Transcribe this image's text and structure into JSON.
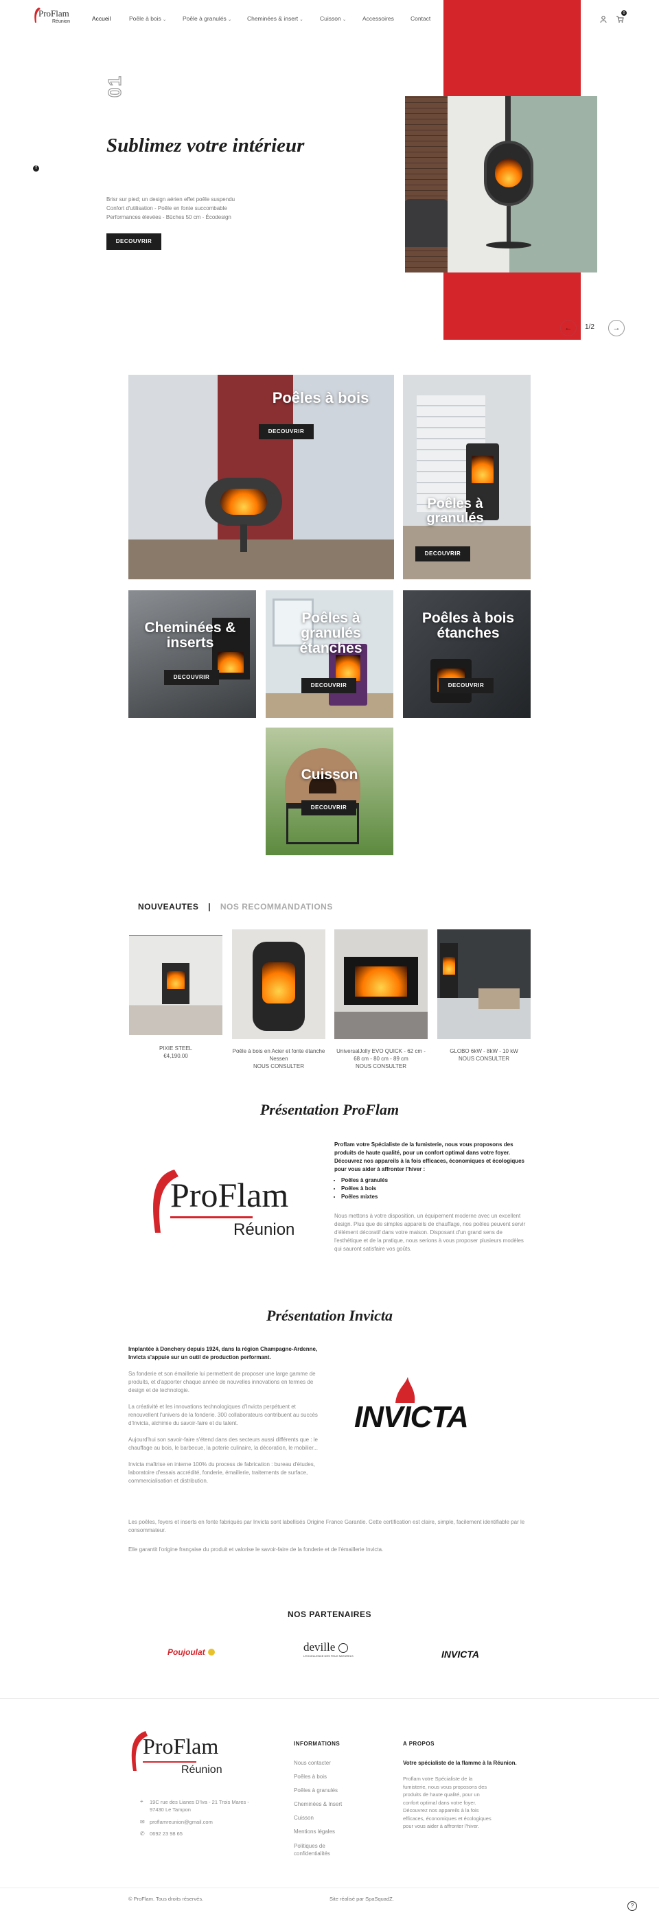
{
  "header": {
    "logo_main": "ProFlam",
    "logo_sub": "Réunion",
    "nav": [
      {
        "label": "Accueil",
        "chevron": false
      },
      {
        "label": "Poêle à bois",
        "chevron": true
      },
      {
        "label": "Poêle à granulés",
        "chevron": true
      },
      {
        "label": "Cheminées & insert",
        "chevron": true
      },
      {
        "label": "Cuisson",
        "chevron": true
      },
      {
        "label": "Accessoires",
        "chevron": false
      },
      {
        "label": "Contact",
        "chevron": false
      }
    ],
    "cart_count": "0"
  },
  "hero": {
    "slide_number": "01",
    "title": "Sublimez votre intérieur",
    "lines": [
      "Brisr sur pied; un design aérien effet poêle suspendu",
      "Confort d'utilisation - Poêle en fonte succombable",
      "Performances élevées - Bûches 50 cm - Écodesign"
    ],
    "button": "DECOUVRIR",
    "pager": "1/2"
  },
  "categories": {
    "button": "DECOUVRIR",
    "items": [
      "Poêles à bois",
      "Poêles à granulés",
      "Cheminées & inserts",
      "Poêles à granulés étanches",
      "Poêles à bois étanches",
      "Cuisson"
    ]
  },
  "products_tabs": {
    "active": "NOUVEAUTES",
    "separator": "|",
    "inactive": "NOS RECOMMANDATIONS"
  },
  "products": [
    {
      "name": "PIXIE STEEL",
      "price": "€4,190.00"
    },
    {
      "name": "Poêle à bois en Acier et fonte étanche Nessen",
      "price": "NOUS CONSULTER"
    },
    {
      "name": "UniversalJolly EVO QUICK - 62 cm - 68 cm - 80 cm - 89 cm",
      "price": "NOUS CONSULTER"
    },
    {
      "name": "GLOBO 6kW - 8kW - 10 kW",
      "price": "NOUS CONSULTER"
    }
  ],
  "presentation_proflam": {
    "title": "Présentation ProFlam",
    "intro": "Proflam votre Spécialiste de la fumisterie, nous vous proposons des produits de haute qualité, pour un confort optimal dans votre foyer. Découvrez nos appareils à la fois efficaces, économiques et écologiques pour vous aider à affronter l'hiver :",
    "bullets": [
      "Poêles à granulés",
      "Poêles à bois",
      "Poêles mixtes"
    ],
    "body": "Nous mettons à votre disposition, un équipement moderne avec un excellent design. Plus que de simples appareils de chauffage, nos poêles peuvent servir d'élément décoratif dans votre maison. Disposant d'un grand sens de l'esthétique et de la pratique, nous serions à vous proposer plusieurs modèles qui sauront satisfaire vos goûts.",
    "logo_main": "ProFlam",
    "logo_sub": "Réunion"
  },
  "presentation_invicta": {
    "title": "Présentation Invicta",
    "intro": "Implantée à Donchery depuis 1924, dans la région Champagne-Ardenne, Invicta s'appuie sur un outil de production performant.",
    "paragraphs": [
      "Sa fonderie et son émaillerie lui permettent de proposer une large gamme de produits, et d'apporter chaque année de nouvelles innovations en termes de design et de technologie.",
      "La créativité et les innovations technologiques d'Invicta perpétuent et renouvellent l'univers de la fonderie. 300 collaborateurs contribuent au succès d'Invicta, alchimie du savoir-faire et du talent.",
      "Aujourd'hui son savoir-faire s'étend dans des secteurs aussi différents que : le chauffage au bois, le barbecue, la poterie culinaire, la décoration, le mobilier...",
      "Invicta maîtrise en interne 100% du process de fabrication : bureau d'études, laboratoire d'essais accrédité, fonderie, émaillerie, traitements de surface, commercialisation et distribution."
    ],
    "full_1": "Les poêles, foyers et inserts en fonte fabriqués par Invicta sont labellisés Origine France Garantie. Cette certification est claire, simple, facilement identifiable par le consommateur.",
    "full_2": "Elle garantit l'origine française du produit et valorise le savoir-faire de la fonderie et de l'émaillerie Invicta.",
    "logo": "INVICTA"
  },
  "partners": {
    "title": "NOS PARTENAIRES",
    "poujoulat": "Poujoulat",
    "deville": "deville",
    "deville_tag": "L'EXCELLENCE DES FEUX NATURELS",
    "invicta": "INVICTA"
  },
  "footer": {
    "logo_main": "ProFlam",
    "logo_sub": "Réunion",
    "address": "19C rue des Lianes D'Iva - 21 Trois Mares - 97430 Le Tampon",
    "email": "proflamreunion@gmail.com",
    "phone": "0692 23 98 65",
    "info_title": "INFORMATIONS",
    "info_links": [
      "Nous contacter",
      "Poêles à bois",
      "Poêles à granulés",
      "Cheminées & Insert",
      "Cuisson",
      "Mentions légales",
      "Politiques de confidentialités"
    ],
    "about_title": "A PROPOS",
    "about_bold": "Votre spécialiste de la flamme à la Réunion.",
    "about_text": "Proflam votre Spécialiste de la fumisterie, nous vous proposons des produits de haute qualité, pour un confort optimal dans votre foyer. Découvrez nos appareils à la fois efficaces, économiques et écologiques pour vous aider à affronter l'hiver.",
    "copyright": "© ProFlam. Tous droits réservés.",
    "credit": "Site réalisé par SpaSquadZ."
  },
  "colors": {
    "accent": "#d4252b",
    "dark": "#1e1e1e",
    "sage": "#9fb2a6"
  }
}
